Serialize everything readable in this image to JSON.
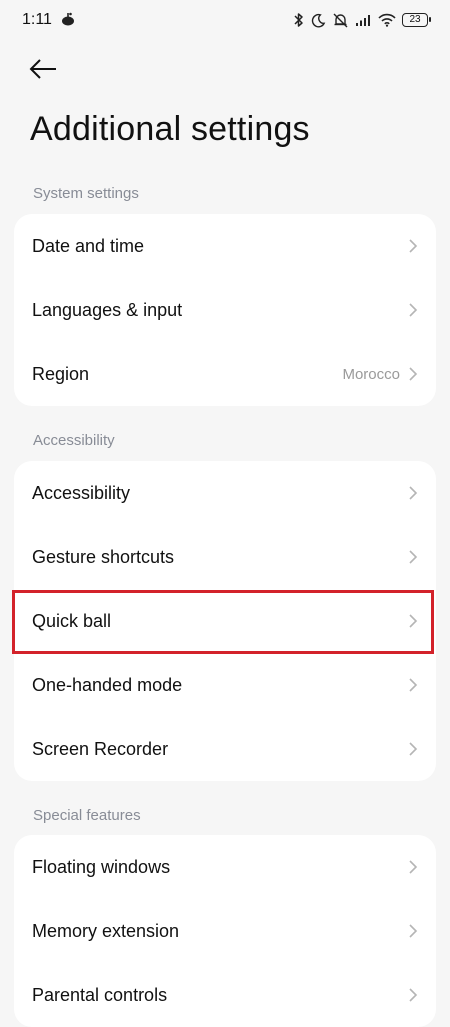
{
  "status_bar": {
    "time": "1:11",
    "battery_level": "23",
    "icons": [
      "notification-app-icon",
      "bluetooth-icon",
      "moon-icon",
      "alarm-off-icon",
      "signal-icon",
      "wifi-icon",
      "battery-icon"
    ]
  },
  "header": {
    "back_icon": "back-arrow-icon",
    "title": "Additional settings"
  },
  "sections": [
    {
      "header": "System settings",
      "items": [
        {
          "label": "Date and time",
          "value": ""
        },
        {
          "label": "Languages & input",
          "value": ""
        },
        {
          "label": "Region",
          "value": "Morocco"
        }
      ]
    },
    {
      "header": "Accessibility",
      "items": [
        {
          "label": "Accessibility",
          "value": ""
        },
        {
          "label": "Gesture shortcuts",
          "value": ""
        },
        {
          "label": "Quick ball",
          "value": ""
        },
        {
          "label": "One-handed mode",
          "value": ""
        },
        {
          "label": "Screen Recorder",
          "value": ""
        }
      ]
    },
    {
      "header": "Special features",
      "items": [
        {
          "label": "Floating windows",
          "value": ""
        },
        {
          "label": "Memory extension",
          "value": ""
        },
        {
          "label": "Parental controls",
          "value": ""
        }
      ]
    }
  ],
  "highlight": {
    "item": "Quick ball",
    "color": "#d3222a"
  },
  "colors": {
    "background": "#f6f6f6",
    "card": "#ffffff",
    "section_header": "#888c96",
    "value_text": "#9a9a9a"
  }
}
